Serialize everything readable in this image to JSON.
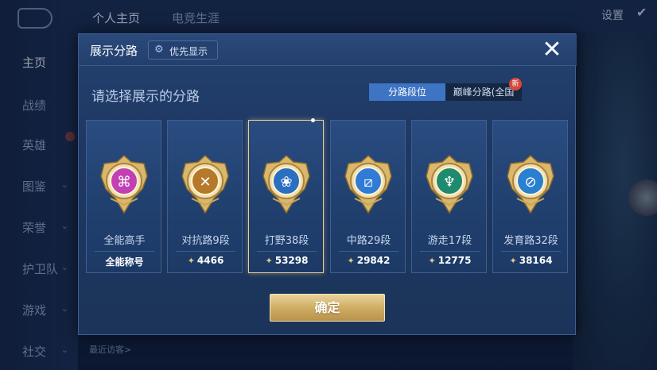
{
  "background": {
    "nav_items": [
      {
        "label": "主页",
        "active": true
      },
      {
        "label": "战绩"
      },
      {
        "label": "英雄"
      },
      {
        "label": "图鉴"
      },
      {
        "label": "荣誉"
      },
      {
        "label": "护卫队"
      },
      {
        "label": "游戏"
      },
      {
        "label": "社交"
      }
    ],
    "top_tabs": [
      {
        "label": "个人主页",
        "active": true
      },
      {
        "label": "电竞生涯"
      }
    ],
    "settings_label": "设置",
    "recent_visitors_label": "最近访客>"
  },
  "dialog": {
    "title": "展示分路",
    "pref_button": "优先显示",
    "prompt": "请选择展示的分路",
    "segment_tabs": [
      {
        "label": "分路段位",
        "active": true
      },
      {
        "label": "巅峰分路(全国",
        "badge": "新"
      }
    ],
    "cards": [
      {
        "name": "全能高手",
        "value": "全能称号",
        "show_icon": false,
        "selected": false,
        "emblem": "versatile-emblem-icon",
        "color": "#c23fb4"
      },
      {
        "name": "对抗路9段",
        "value": "4466",
        "show_icon": true,
        "selected": false,
        "emblem": "clash-lane-emblem-icon",
        "color": "#b5792c"
      },
      {
        "name": "打野38段",
        "value": "53298",
        "show_icon": true,
        "selected": true,
        "emblem": "jungle-emblem-icon",
        "color": "#2a6fc2"
      },
      {
        "name": "中路29段",
        "value": "29842",
        "show_icon": true,
        "selected": false,
        "emblem": "mid-lane-emblem-icon",
        "color": "#2f7bd6"
      },
      {
        "name": "游走17段",
        "value": "12775",
        "show_icon": true,
        "selected": false,
        "emblem": "roam-emblem-icon",
        "color": "#1e8a6e"
      },
      {
        "name": "发育路32段",
        "value": "38164",
        "show_icon": true,
        "selected": false,
        "emblem": "farm-lane-emblem-icon",
        "color": "#2b7fd0"
      }
    ],
    "confirm_button": "确定"
  }
}
